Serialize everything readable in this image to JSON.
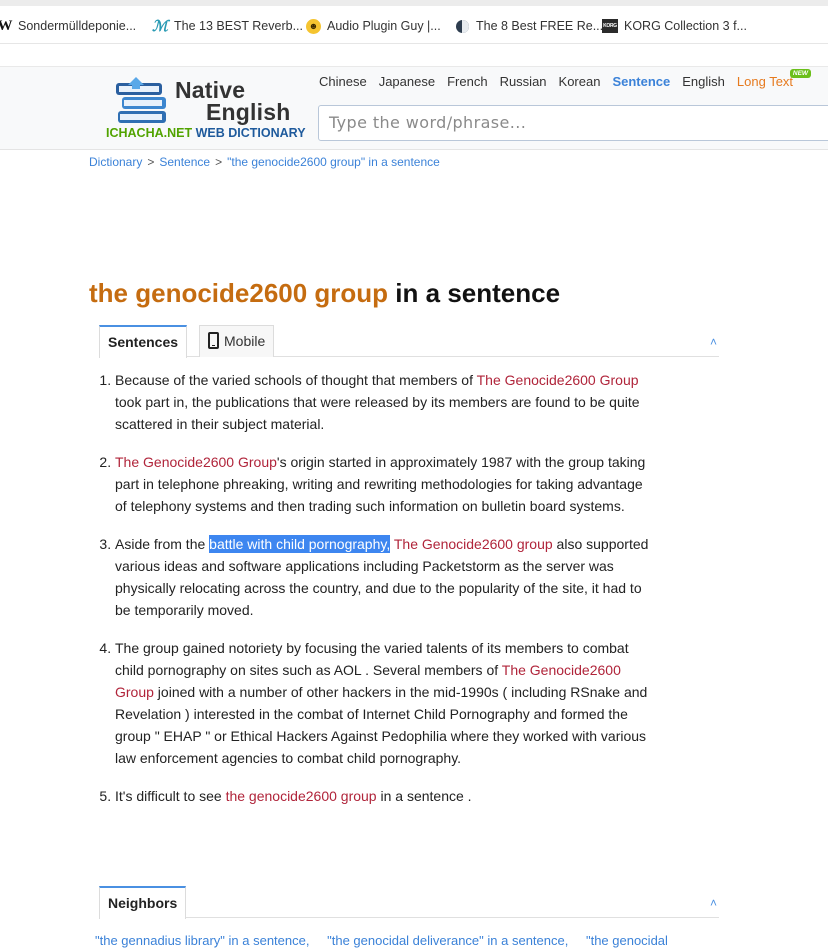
{
  "bookmarks": [
    {
      "icon": "wikipedia-icon",
      "label": "Sondermülldeponie..."
    },
    {
      "icon": "m-icon",
      "label": "The 13 BEST Reverb..."
    },
    {
      "icon": "audio-plugin-guy-icon",
      "label": "Audio Plugin Guy |..."
    },
    {
      "icon": "sound-icon",
      "label": "The 8 Best FREE Re..."
    },
    {
      "icon": "korg-icon",
      "label": "KORG Collection 3 f..."
    }
  ],
  "logo": {
    "line1": "Native",
    "line2": "English",
    "site": "ICHACHA.NET",
    "tagline": "WEB DICTIONARY"
  },
  "nav": {
    "chinese": "Chinese",
    "japanese": "Japanese",
    "french": "French",
    "russian": "Russian",
    "korean": "Korean",
    "sentence": "Sentence",
    "english": "English",
    "long_text": "Long Text",
    "new_badge": "NEW"
  },
  "search": {
    "placeholder": "Type the word/phrase..."
  },
  "breadcrumb": {
    "dictionary": "Dictionary",
    "sep": ">",
    "sentence": "Sentence",
    "current": "\"the genocide2600 group\" in a sentence"
  },
  "title": {
    "keyword": "the genocide2600 group",
    "suffix": " in a sentence"
  },
  "tabs": {
    "sentences": "Sentences",
    "mobile": "Mobile",
    "collapse": "^"
  },
  "sentences": [
    {
      "parts": [
        {
          "t": "Because of the varied schools of thought that members of "
        },
        {
          "t": "The Genocide2600 Group",
          "hl": true
        },
        {
          "t": " took part in, the publications that were released by its members are found to be quite scattered in their subject material."
        }
      ]
    },
    {
      "parts": [
        {
          "t": "The Genocide2600 Group",
          "hl": true
        },
        {
          "t": "'s origin started in approximately 1987 with the group taking part in telephone phreaking, writing and rewriting methodologies for taking advantage of telephony systems and then trading such information on bulletin board systems."
        }
      ]
    },
    {
      "parts": [
        {
          "t": "Aside from the "
        },
        {
          "t": "battle with child pornography,",
          "sel": true
        },
        {
          "t": " "
        },
        {
          "t": "The Genocide2600 group",
          "hl": true
        },
        {
          "t": " also supported various ideas and software applications including Packetstorm as the server was physically relocating across the country, and due to the popularity of the site, it had to be temporarily moved."
        }
      ]
    },
    {
      "parts": [
        {
          "t": "The group gained notoriety by focusing the varied talents of its members to combat child pornography on sites such as AOL . Several members of "
        },
        {
          "t": "The Genocide2600 Group",
          "hl": true
        },
        {
          "t": " joined with a number of other hackers in the mid-1990s ( including RSnake and Revelation ) interested in the combat of Internet Child Pornography and formed the group \" EHAP \" or Ethical Hackers Against Pedophilia where they worked with various law enforcement agencies to combat child pornography."
        }
      ]
    },
    {
      "parts": [
        {
          "t": "It's difficult to see "
        },
        {
          "t": "the genocide2600 group",
          "hl": true
        },
        {
          "t": " in a sentence ."
        }
      ]
    }
  ],
  "neighbors": {
    "label": "Neighbors",
    "items": [
      "\"the gennadius library\" in a sentence,",
      "\"the genocidal deliverance\" in a sentence,",
      "\"the genocidal"
    ]
  },
  "colors": {
    "keyword": "#c56c10",
    "highlight": "#b0243a",
    "link": "#3b82d8",
    "selection": "#3d86f0"
  }
}
